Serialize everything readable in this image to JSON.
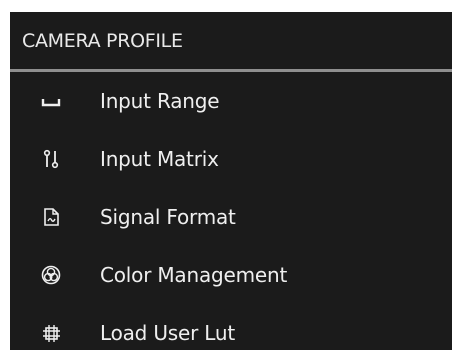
{
  "header": {
    "title": "CAMERA PROFILE"
  },
  "menu": {
    "items": [
      {
        "label": "Input Range",
        "icon": "range-bracket-icon"
      },
      {
        "label": "Input Matrix",
        "icon": "matrix-swap-icon"
      },
      {
        "label": "Signal Format",
        "icon": "signal-file-icon"
      },
      {
        "label": "Color Management",
        "icon": "color-wheel-icon"
      },
      {
        "label": "Load User Lut",
        "icon": "lut-cube-icon"
      }
    ]
  },
  "colors": {
    "panel_background": "#1b1b1b",
    "header_divider": "#8f8f8f",
    "text": "#efefef"
  }
}
